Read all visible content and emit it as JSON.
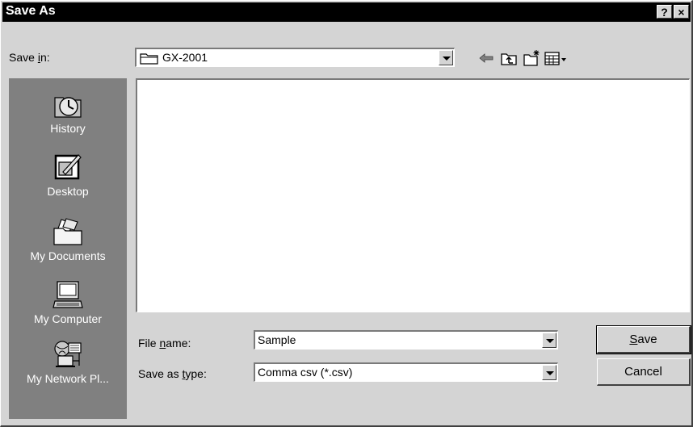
{
  "dialog": {
    "title": "Save As",
    "help_button": "?",
    "close_button": "×"
  },
  "save_in": {
    "label_pre": "Save ",
    "label_u": "i",
    "label_post": "n:",
    "value": "GX-2001"
  },
  "places": [
    {
      "label": "History",
      "icon": "history-icon"
    },
    {
      "label": "Desktop",
      "icon": "desktop-icon"
    },
    {
      "label": "My Documents",
      "icon": "my-documents-icon"
    },
    {
      "label": "My Computer",
      "icon": "my-computer-icon"
    },
    {
      "label": "My Network Pl...",
      "icon": "my-network-places-icon"
    }
  ],
  "file_name": {
    "label_pre": "File ",
    "label_u": "n",
    "label_post": "ame:",
    "value": "Sample"
  },
  "save_as_type": {
    "label_pre": "Save as ",
    "label_u": "t",
    "label_post": "ype:",
    "value": "Comma csv (*.csv)"
  },
  "buttons": {
    "save_u": "S",
    "save_rest": "ave",
    "cancel": "Cancel"
  },
  "toolbar_icons": [
    "back-arrow-icon",
    "up-one-level-icon",
    "new-folder-icon",
    "view-menu-icon"
  ]
}
